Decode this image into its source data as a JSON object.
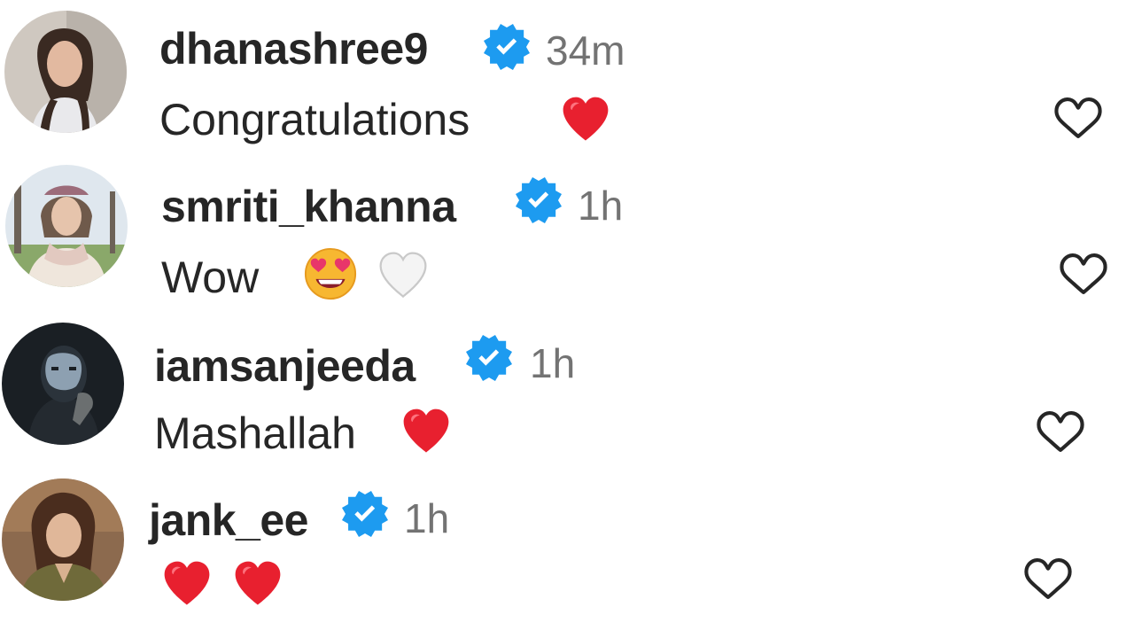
{
  "comments": [
    {
      "username": "dhanashree9",
      "verified": true,
      "time": "34m",
      "text": "Congratulations",
      "emojis": [
        "red-heart"
      ],
      "avatar": "woman-portrait-dark-hair"
    },
    {
      "username": "smriti_khanna",
      "verified": true,
      "time": "1h",
      "text": "Wow",
      "emojis": [
        "heart-eyes-face",
        "white-heart"
      ],
      "avatar": "woman-with-headband-outdoors"
    },
    {
      "username": "iamsanjeeda",
      "verified": true,
      "time": "1h",
      "text": "Mashallah",
      "emojis": [
        "red-heart"
      ],
      "avatar": "dark-portrait-with-face-light"
    },
    {
      "username": "jank_ee",
      "verified": true,
      "time": "1h",
      "text": "",
      "emojis": [
        "red-heart",
        "red-heart"
      ],
      "avatar": "woman-portrait-curly-hair"
    }
  ],
  "colors": {
    "verified_badge": "#1d9bf0",
    "username": "#262626",
    "timestamp": "#737373",
    "like_outline": "#262626",
    "red_heart": "#e8202f"
  }
}
